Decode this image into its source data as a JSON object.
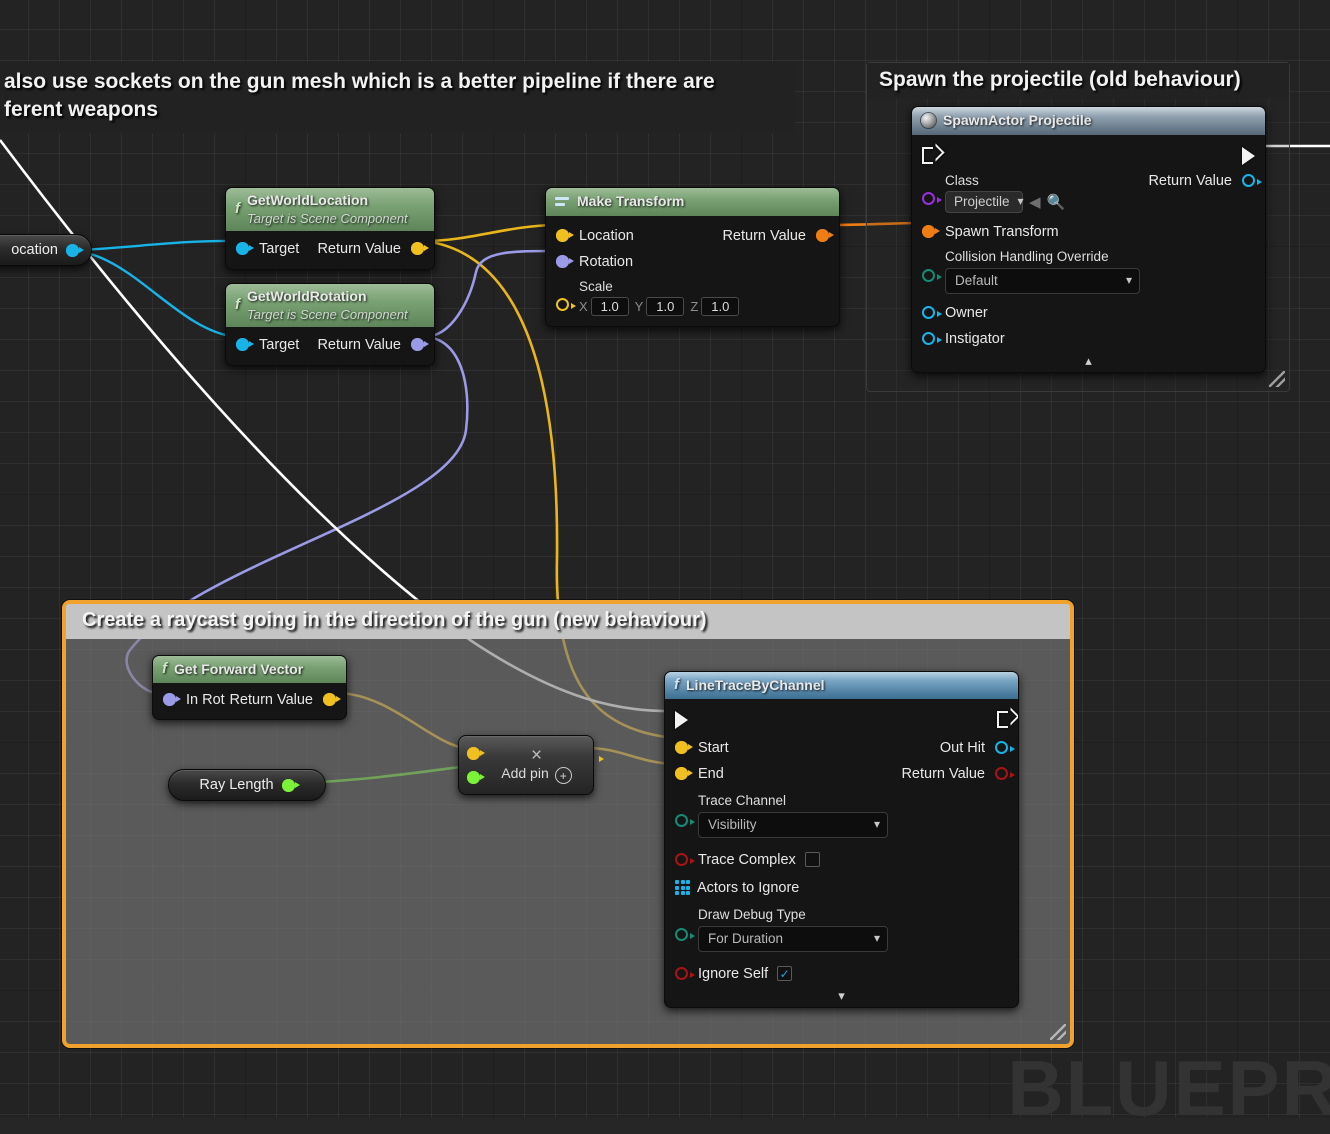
{
  "app": {
    "watermark": "BLUEPR"
  },
  "comments": [
    {
      "id": "sockets-comment",
      "title": "also use sockets on the gun mesh which is a better pipeline if there are",
      "title_line2": "ferent weapons"
    },
    {
      "id": "spawn-comment",
      "title": "Spawn the projectile (old behaviour)"
    },
    {
      "id": "raycast-comment",
      "title": "Create a raycast going in the direction of the gun (new behaviour)"
    }
  ],
  "nodes": {
    "gun_location_var": {
      "label": "ocation"
    },
    "get_world_location": {
      "title": "GetWorldLocation",
      "subtitle": "Target is Scene Component",
      "input": "Target",
      "output": "Return Value"
    },
    "get_world_rotation": {
      "title": "GetWorldRotation",
      "subtitle": "Target is Scene Component",
      "input": "Target",
      "output": "Return Value"
    },
    "make_transform": {
      "title": "Make Transform",
      "location": "Location",
      "rotation": "Rotation",
      "scale": "Scale",
      "scale_x_axis": "X",
      "scale_x": "1.0",
      "scale_y_axis": "Y",
      "scale_y": "1.0",
      "scale_z_axis": "Z",
      "scale_z": "1.0",
      "output": "Return Value"
    },
    "spawn_actor": {
      "title": "SpawnActor Projectile",
      "class_label": "Class",
      "class_value": "Projectile",
      "spawn_transform": "Spawn Transform",
      "collision_label": "Collision Handling Override",
      "collision_value": "Default",
      "owner": "Owner",
      "instigator": "Instigator",
      "return_value": "Return Value"
    },
    "get_forward_vector": {
      "title": "Get Forward Vector",
      "input": "In Rot",
      "output": "Return Value"
    },
    "ray_length_var": {
      "label": "Ray Length"
    },
    "multiply": {
      "symbol": "×",
      "add_pin": "Add pin",
      "plus": "+"
    },
    "line_trace": {
      "title": "LineTraceByChannel",
      "start": "Start",
      "end": "End",
      "trace_channel_label": "Trace Channel",
      "trace_channel_value": "Visibility",
      "trace_complex": "Trace Complex",
      "trace_complex_checked": "",
      "actors_to_ignore": "Actors to Ignore",
      "draw_debug_label": "Draw Debug Type",
      "draw_debug_value": "For Duration",
      "ignore_self": "Ignore Self",
      "ignore_self_checked": "✓",
      "out_hit": "Out Hit",
      "return_value": "Return Value"
    }
  },
  "colors": {
    "comment_selected_border": "#f0a22c",
    "vector_pin": "#f0c020",
    "rotator_pin": "#9a9ae6",
    "transform_pin": "#ef7d13",
    "object_pin": "#18b4e8",
    "class_pin": "#9b2ee0",
    "enum_pin": "#148b74",
    "bool_pin": "#a81414",
    "float_pin": "#7bf13a",
    "exec_wire": "#ffffff"
  }
}
